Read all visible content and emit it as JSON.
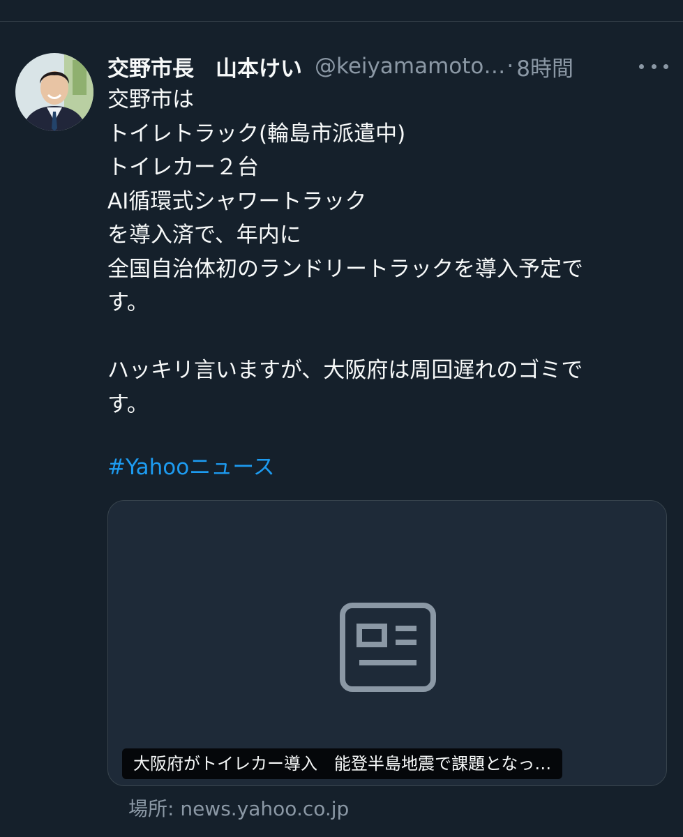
{
  "tweet": {
    "display_name": "交野市長　山本けい",
    "handle": "@keiyamamoto…",
    "separator": "·",
    "time": "8時間",
    "text_lines": [
      "交野市は",
      "トイレトラック(輪島市派遣中)",
      "トイレカー２台",
      "AI循環式シャワートラック",
      "を導入済で、年内に",
      "全国自治体初のランドリートラックを導入予定で",
      "す。",
      "",
      "ハッキリ言いますが、大阪府は周回遅れのゴミで",
      "す。"
    ],
    "hashtag": "#Yahooニュース",
    "more_icon": "more-horizontal-icon"
  },
  "card": {
    "title": "大阪府がトイレカー導入　能登半島地震で課題となっ…",
    "source": "場所: news.yahoo.co.jp",
    "icon": "news-article-icon"
  },
  "colors": {
    "background": "#15202b",
    "text": "#f7f9f9",
    "secondary": "#8b98a5",
    "link": "#1d9bf0",
    "card": "#1e2a38"
  }
}
